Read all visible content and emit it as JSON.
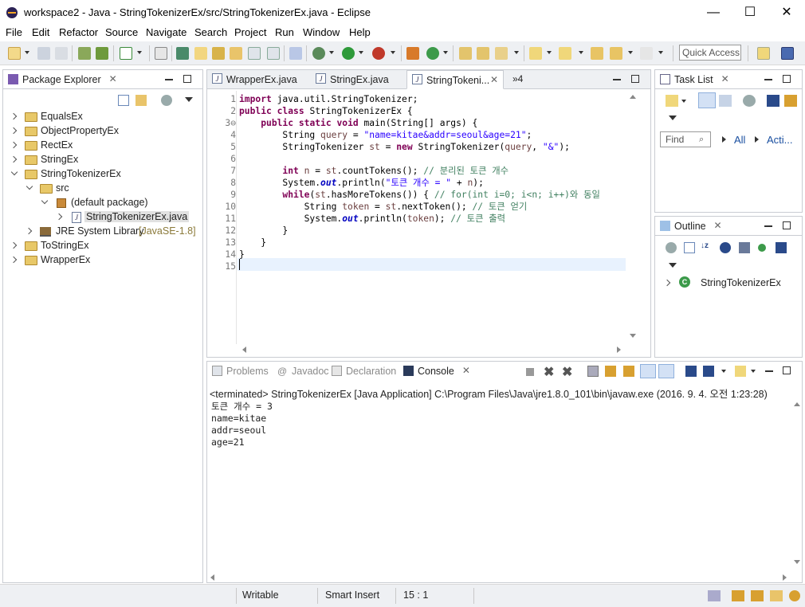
{
  "window": {
    "title": "workspace2 - Java - StringTokenizerEx/src/StringTokenizerEx.java - Eclipse",
    "minimize": "—",
    "maximize": "☐",
    "close": "✕"
  },
  "menu": [
    "File",
    "Edit",
    "Refactor",
    "Source",
    "Navigate",
    "Search",
    "Project",
    "Run",
    "Window",
    "Help"
  ],
  "toolbar": {
    "quick_access_placeholder": "Quick Access"
  },
  "package_explorer": {
    "tab_label": "Package Explorer",
    "items": [
      {
        "label": "EqualsEx",
        "level": 0,
        "expanded": false,
        "kind": "project"
      },
      {
        "label": "ObjectPropertyEx",
        "level": 0,
        "expanded": false,
        "kind": "project"
      },
      {
        "label": "RectEx",
        "level": 0,
        "expanded": false,
        "kind": "project"
      },
      {
        "label": "StringEx",
        "level": 0,
        "expanded": false,
        "kind": "project"
      },
      {
        "label": "StringTokenizerEx",
        "level": 0,
        "expanded": true,
        "kind": "project"
      },
      {
        "label": "src",
        "level": 1,
        "expanded": true,
        "kind": "source-folder"
      },
      {
        "label": "(default package)",
        "level": 2,
        "expanded": true,
        "kind": "package"
      },
      {
        "label": "StringTokenizerEx.java",
        "level": 3,
        "expanded": false,
        "kind": "java-file",
        "selected": true
      },
      {
        "label": "JRE System Library",
        "suffix": "[JavaSE-1.8]",
        "level": 1,
        "expanded": false,
        "kind": "library"
      },
      {
        "label": "ToStringEx",
        "level": 0,
        "expanded": false,
        "kind": "project"
      },
      {
        "label": "WrapperEx",
        "level": 0,
        "expanded": false,
        "kind": "project"
      }
    ]
  },
  "editor": {
    "tabs": [
      {
        "label": "WrapperEx.java",
        "active": false
      },
      {
        "label": "StringEx.java",
        "active": false
      },
      {
        "label": "StringTokeni...",
        "active": true
      }
    ],
    "overflow_label": "»4",
    "lines": [
      {
        "n": "1",
        "html": "<span class='kw'>import</span> java.util.StringTokenizer;"
      },
      {
        "n": "2",
        "html": "<span class='kw'>public</span> <span class='kw'>class</span> StringTokenizerEx {"
      },
      {
        "n": "3⊖",
        "html": "    <span class='kw'>public</span> <span class='kw'>static</span> <span class='kw'>void</span> main(String[] args) {"
      },
      {
        "n": "4",
        "html": "        String <span class='var'>query</span> = <span class='str'>\"name=kitae&amp;addr=seoul&amp;age=21\"</span>;"
      },
      {
        "n": "5",
        "html": "        StringTokenizer <span class='var'>st</span> = <span class='kw'>new</span> StringTokenizer(<span class='var'>query</span>, <span class='str'>\"&amp;\"</span>);"
      },
      {
        "n": "6",
        "html": ""
      },
      {
        "n": "7",
        "html": "        <span class='kw'>int</span> <span class='var'>n</span> = <span class='var'>st</span>.countTokens(); <span class='cm'>// 분리된 토큰 개수</span>"
      },
      {
        "n": "8",
        "html": "        System.<span class='fld'>out</span>.println(<span class='str'>\"토큰 개수 = \"</span> + <span class='var'>n</span>);"
      },
      {
        "n": "9",
        "html": "        <span class='kw'>while</span>(<span class='var'>st</span>.hasMoreTokens()) { <span class='cm'>// for(int i=0; i&lt;n; i++)와 동일</span>"
      },
      {
        "n": "10",
        "html": "            String <span class='var'>token</span> = <span class='var'>st</span>.nextToken(); <span class='cm'>// 토큰 얻기</span>"
      },
      {
        "n": "11",
        "html": "            System.<span class='fld'>out</span>.println(<span class='var'>token</span>); <span class='cm'>// 토큰 출력</span>"
      },
      {
        "n": "12",
        "html": "        }"
      },
      {
        "n": "13",
        "html": "    }"
      },
      {
        "n": "14",
        "html": "}"
      },
      {
        "n": "15",
        "html": ""
      }
    ]
  },
  "task_list": {
    "tab_label": "Task List",
    "find_placeholder": "Find",
    "all_label": "All",
    "acti_label": "Acti..."
  },
  "outline": {
    "tab_label": "Outline",
    "item": "StringTokenizerEx"
  },
  "bottom_tabs": [
    {
      "label": "Problems",
      "active": false
    },
    {
      "label": "Javadoc",
      "active": false
    },
    {
      "label": "Declaration",
      "active": false
    },
    {
      "label": "Console",
      "active": true
    }
  ],
  "console": {
    "terminated": "<terminated> StringTokenizerEx [Java Application] C:\\Program Files\\Java\\jre1.8.0_101\\bin\\javaw.exe (2016. 9. 4. 오전 1:23:28)",
    "output": [
      "토큰 개수 = 3",
      "name=kitae",
      "addr=seoul",
      "age=21"
    ]
  },
  "status": {
    "mode": "Writable",
    "insert": "Smart Insert",
    "position": "15 : 1"
  }
}
